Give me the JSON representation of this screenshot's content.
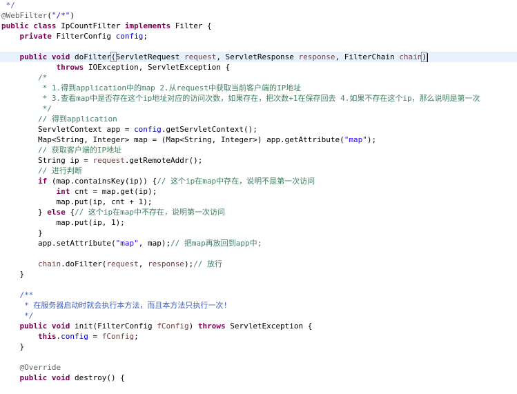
{
  "editor": {
    "lines": [
      [
        {
          "t": " */",
          "c": "doc"
        }
      ],
      [
        {
          "t": "@WebFilter",
          "c": "ann"
        },
        {
          "t": "(",
          "c": "plain"
        },
        {
          "t": "\"/*\"",
          "c": "str"
        },
        {
          "t": ")",
          "c": "plain"
        }
      ],
      [
        {
          "t": "public",
          "c": "kw"
        },
        {
          "t": " ",
          "c": "plain"
        },
        {
          "t": "class",
          "c": "kw"
        },
        {
          "t": " IpCountFilter ",
          "c": "plain"
        },
        {
          "t": "implements",
          "c": "kw"
        },
        {
          "t": " Filter {",
          "c": "plain"
        }
      ],
      [
        {
          "t": "    ",
          "c": "plain"
        },
        {
          "t": "private",
          "c": "kw"
        },
        {
          "t": " FilterConfig ",
          "c": "plain"
        },
        {
          "t": "config",
          "c": "field"
        },
        {
          "t": ";",
          "c": "plain"
        }
      ],
      [],
      [
        {
          "t": "    ",
          "c": "plain"
        },
        {
          "t": "public",
          "c": "kw"
        },
        {
          "t": " ",
          "c": "plain"
        },
        {
          "t": "void",
          "c": "kw"
        },
        {
          "t": " doFilter",
          "c": "plain"
        },
        {
          "t": "(",
          "c": "bracket"
        },
        {
          "t": "ServletRequest ",
          "c": "plain"
        },
        {
          "t": "request",
          "c": "param"
        },
        {
          "t": ", ServletResponse ",
          "c": "plain"
        },
        {
          "t": "response",
          "c": "param"
        },
        {
          "t": ", FilterChain ",
          "c": "plain"
        },
        {
          "t": "chain",
          "c": "param"
        },
        {
          "t": ")",
          "c": "bracket"
        }
      ],
      [
        {
          "t": "            ",
          "c": "plain"
        },
        {
          "t": "throws",
          "c": "kw"
        },
        {
          "t": " IOException, ServletException {",
          "c": "plain"
        }
      ],
      [
        {
          "t": "        /*",
          "c": "comment"
        }
      ],
      [
        {
          "t": "         * 1.得到application中的map 2.从request中获取当前客户端的IP地址",
          "c": "comment"
        }
      ],
      [
        {
          "t": "         * 3.查看map中是否存在这个ip地址对应的访问次数，如果存在，把次数+1在保存回去 4.如果不存在这个ip，那么说明是第一次",
          "c": "comment"
        }
      ],
      [
        {
          "t": "         */",
          "c": "comment"
        }
      ],
      [
        {
          "t": "        // 得到application",
          "c": "comment"
        }
      ],
      [
        {
          "t": "        ServletContext app = ",
          "c": "plain"
        },
        {
          "t": "config",
          "c": "field"
        },
        {
          "t": ".getServletContext();",
          "c": "plain"
        }
      ],
      [
        {
          "t": "        Map<String, Integer> map = (Map<String, Integer>) app.getAttribute(",
          "c": "plain"
        },
        {
          "t": "\"map\"",
          "c": "str"
        },
        {
          "t": ");",
          "c": "plain"
        }
      ],
      [
        {
          "t": "        // 获取客户端的IP地址",
          "c": "comment"
        }
      ],
      [
        {
          "t": "        String ip = ",
          "c": "plain"
        },
        {
          "t": "request",
          "c": "param"
        },
        {
          "t": ".getRemoteAddr();",
          "c": "plain"
        }
      ],
      [
        {
          "t": "        // 进行判断",
          "c": "comment"
        }
      ],
      [
        {
          "t": "        ",
          "c": "plain"
        },
        {
          "t": "if",
          "c": "kw"
        },
        {
          "t": " (map.containsKey(ip)) {",
          "c": "plain"
        },
        {
          "t": "// 这个ip在map中存在，说明不是第一次访问",
          "c": "comment"
        }
      ],
      [
        {
          "t": "            ",
          "c": "plain"
        },
        {
          "t": "int",
          "c": "kw"
        },
        {
          "t": " cnt = map.get(ip);",
          "c": "plain"
        }
      ],
      [
        {
          "t": "            map.put(ip, cnt + 1);",
          "c": "plain"
        }
      ],
      [
        {
          "t": "        } ",
          "c": "plain"
        },
        {
          "t": "else",
          "c": "kw"
        },
        {
          "t": " {",
          "c": "plain"
        },
        {
          "t": "// 这个ip在map中不存在，说明第一次访问",
          "c": "comment"
        }
      ],
      [
        {
          "t": "            map.put(ip, 1);",
          "c": "plain"
        }
      ],
      [
        {
          "t": "        }",
          "c": "plain"
        }
      ],
      [
        {
          "t": "        app.setAttribute(",
          "c": "plain"
        },
        {
          "t": "\"map\"",
          "c": "str"
        },
        {
          "t": ", map);",
          "c": "plain"
        },
        {
          "t": "// 把map再放回到app中;",
          "c": "comment"
        }
      ],
      [],
      [
        {
          "t": "        ",
          "c": "plain"
        },
        {
          "t": "chain",
          "c": "param"
        },
        {
          "t": ".doFilter(",
          "c": "plain"
        },
        {
          "t": "request",
          "c": "param"
        },
        {
          "t": ", ",
          "c": "plain"
        },
        {
          "t": "response",
          "c": "param"
        },
        {
          "t": ");",
          "c": "plain"
        },
        {
          "t": "// 放行",
          "c": "comment"
        }
      ],
      [
        {
          "t": "    }",
          "c": "plain"
        }
      ],
      [],
      [
        {
          "t": "    /**",
          "c": "doc"
        }
      ],
      [
        {
          "t": "     * 在服务器启动时就会执行本方法，而且本方法只执行一次!",
          "c": "doc"
        }
      ],
      [
        {
          "t": "     */",
          "c": "doc"
        }
      ],
      [
        {
          "t": "    ",
          "c": "plain"
        },
        {
          "t": "public",
          "c": "kw"
        },
        {
          "t": " ",
          "c": "plain"
        },
        {
          "t": "void",
          "c": "kw"
        },
        {
          "t": " init(FilterConfig ",
          "c": "plain"
        },
        {
          "t": "fConfig",
          "c": "param"
        },
        {
          "t": ") ",
          "c": "plain"
        },
        {
          "t": "throws",
          "c": "kw"
        },
        {
          "t": " ServletException {",
          "c": "plain"
        }
      ],
      [
        {
          "t": "        ",
          "c": "plain"
        },
        {
          "t": "this",
          "c": "kw"
        },
        {
          "t": ".",
          "c": "plain"
        },
        {
          "t": "config",
          "c": "field"
        },
        {
          "t": " = ",
          "c": "plain"
        },
        {
          "t": "fConfig",
          "c": "param"
        },
        {
          "t": ";",
          "c": "plain"
        }
      ],
      [
        {
          "t": "    }",
          "c": "plain"
        }
      ],
      [],
      [
        {
          "t": "    ",
          "c": "plain"
        },
        {
          "t": "@Override",
          "c": "ann"
        }
      ],
      [
        {
          "t": "    ",
          "c": "plain"
        },
        {
          "t": "public",
          "c": "kw"
        },
        {
          "t": " ",
          "c": "plain"
        },
        {
          "t": "void",
          "c": "kw"
        },
        {
          "t": " destroy() {",
          "c": "plain"
        }
      ]
    ],
    "current_line_index": 5
  },
  "colors": {
    "keyword": "#7f0055",
    "field": "#0000c0",
    "parameter": "#6a3e3e",
    "string": "#2a00ff",
    "comment": "#3f7f5f",
    "javadoc": "#3f5fbf",
    "annotation": "#646464",
    "current_line_highlight": "#e8f2fe"
  }
}
